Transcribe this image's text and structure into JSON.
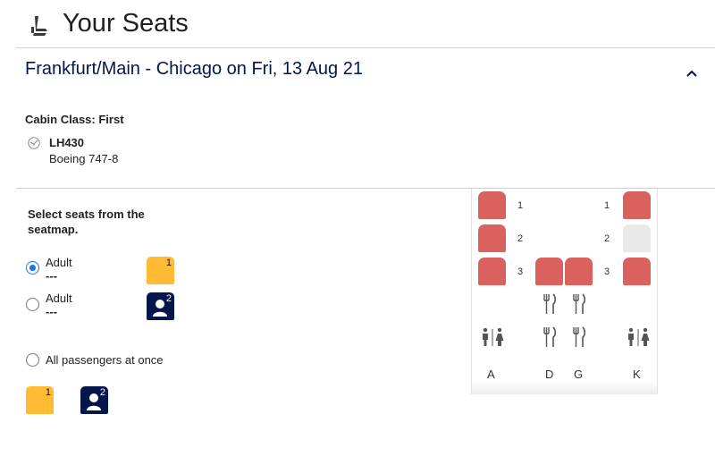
{
  "header": {
    "title": "Your Seats",
    "icon": "seat-icon"
  },
  "flight": {
    "route": "Frankfurt/Main - Chicago on Fri, 13 Aug 21",
    "cabin": "Cabin Class: First",
    "number": "LH430",
    "aircraft": "Boeing 747-8",
    "collapse_icon": "chevron-up-icon"
  },
  "instructions": "Select seats from the seatmap.",
  "passengers": [
    {
      "label": "Adult",
      "seat": "---",
      "selected": true,
      "badge_number": "1",
      "badge_color": "#ffbb33"
    },
    {
      "label": "Adult",
      "seat": "---",
      "selected": false,
      "badge_number": "2",
      "badge_color": "#05164d"
    }
  ],
  "all_passengers": {
    "label": "All passengers at once",
    "selected": false
  },
  "legend": [
    {
      "number": "1",
      "color": "#ffbb33"
    },
    {
      "number": "2",
      "color": "#05164d"
    }
  ],
  "seatmap": {
    "columns": [
      "A",
      "D",
      "G",
      "K"
    ],
    "rows": [
      "1",
      "2",
      "3"
    ],
    "seat_status": {
      "1A": "occupied",
      "1K": "occupied",
      "2A": "occupied",
      "2K": "available",
      "3A": "occupied",
      "3D": "occupied",
      "3G": "occupied",
      "3K": "occupied"
    },
    "colors": {
      "occupied": "#d9625e",
      "available": "#e9e9e9"
    },
    "amenities": [
      "galley-icon",
      "lavatory-icon"
    ]
  }
}
